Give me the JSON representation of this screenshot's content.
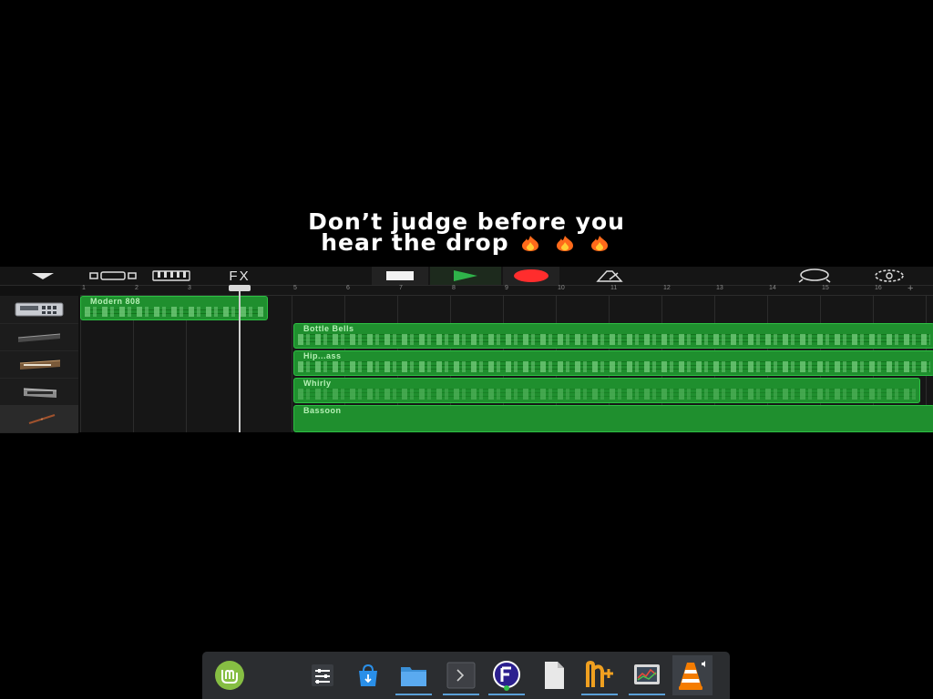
{
  "caption": {
    "line1": "Don’t judge before you",
    "line2": "hear the drop",
    "emoji_icons": [
      "fire-icon",
      "fire-icon",
      "fire-icon"
    ]
  },
  "garageband": {
    "toolbar": {
      "left": [
        "tracks-menu-icon",
        "browser-view-icon",
        "keyboard-icon"
      ],
      "fx_label": "FX",
      "transport": [
        "stop-icon",
        "play-icon",
        "record-icon"
      ],
      "right": [
        "metronome-icon",
        "loop-browser-icon",
        "settings-icon"
      ]
    },
    "ruler": {
      "bars": [
        "1",
        "2",
        "3",
        "4",
        "5",
        "6",
        "7",
        "8",
        "9",
        "10",
        "11",
        "12",
        "13",
        "14",
        "15",
        "16"
      ],
      "add_label": "+"
    },
    "tracks": [
      {
        "instrument_icon": "drum-machine-icon",
        "region": "Modern 808"
      },
      {
        "instrument_icon": "keyboard-instrument-icon",
        "region": "Bottle Bells"
      },
      {
        "instrument_icon": "synth-icon",
        "region": "Hip...ass"
      },
      {
        "instrument_icon": "bass-synth-icon",
        "region": "Whirly"
      },
      {
        "instrument_icon": "bassoon-icon",
        "region": "Bassoon"
      }
    ],
    "colors": {
      "region_fill": "#1f8f2e",
      "region_border": "#2ec044",
      "play": "#2fb34a",
      "record": "#ff2d2d"
    }
  },
  "taskbar": {
    "items": [
      {
        "icon": "linux-mint-menu-icon",
        "state": "normal"
      },
      {
        "icon": "mixer-settings-icon",
        "state": "normal"
      },
      {
        "icon": "software-store-icon",
        "state": "normal"
      },
      {
        "icon": "file-manager-icon",
        "state": "running"
      },
      {
        "icon": "terminal-icon",
        "state": "running"
      },
      {
        "icon": "font-app-icon",
        "state": "running"
      },
      {
        "icon": "text-file-icon",
        "state": "normal"
      },
      {
        "icon": "notepad-plus-icon",
        "state": "running"
      },
      {
        "icon": "system-monitor-icon",
        "state": "running"
      },
      {
        "icon": "vlc-icon",
        "state": "active"
      }
    ]
  }
}
